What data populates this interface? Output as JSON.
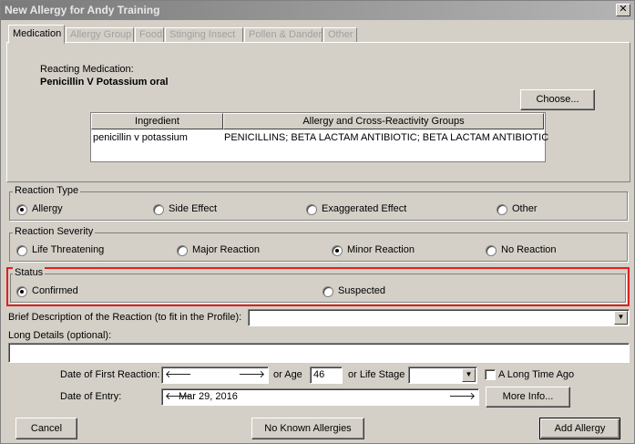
{
  "window": {
    "title": "New Allergy for Andy Training",
    "close_glyph": "✕"
  },
  "tabs": [
    {
      "label": "Medication"
    },
    {
      "label": "Allergy Group"
    },
    {
      "label": "Food"
    },
    {
      "label": "Stinging Insect"
    },
    {
      "label": "Pollen & Dander"
    },
    {
      "label": "Other"
    }
  ],
  "medication": {
    "reacting_label": "Reacting Medication:",
    "name": "Penicillin V Potassium oral",
    "choose_button": "Choose...",
    "grid": {
      "columns": [
        "Ingredient",
        "Allergy and Cross-Reactivity Groups"
      ],
      "rows": [
        [
          "penicillin v potassium",
          "PENICILLINS; BETA LACTAM ANTIBIOTIC; BETA LACTAM ANTIBIOTIC"
        ]
      ]
    }
  },
  "reaction_type": {
    "label": "Reaction Type",
    "options": [
      "Allergy",
      "Side Effect",
      "Exaggerated Effect",
      "Other"
    ],
    "selected": "Allergy"
  },
  "reaction_severity": {
    "label": "Reaction Severity",
    "options": [
      "Life Threatening",
      "Major Reaction",
      "Minor Reaction",
      "No Reaction"
    ],
    "selected": "Minor Reaction"
  },
  "status": {
    "label": "Status",
    "options": [
      "Confirmed",
      "Suspected"
    ],
    "selected": "Confirmed",
    "highlight_color": "#e02020"
  },
  "brief_description": {
    "label": "Brief Description of the Reaction (to fit in the Profile):",
    "value": ""
  },
  "long_details": {
    "label": "Long Details (optional):",
    "value": ""
  },
  "dates": {
    "first_reaction_label": "Date of First Reaction:",
    "first_reaction_value": "",
    "or_age_label": "or Age",
    "age_value": "46",
    "or_life_stage_label": "or Life Stage",
    "life_stage_value": "",
    "long_time_ago_label": "A Long Time Ago",
    "long_time_ago_checked": false,
    "entry_label": "Date of Entry:",
    "entry_value": "Mar 29, 2016",
    "more_info_button": "More Info..."
  },
  "footer": {
    "cancel": "Cancel",
    "no_known_allergies": "No Known Allergies",
    "add_allergy": "Add Allergy"
  }
}
